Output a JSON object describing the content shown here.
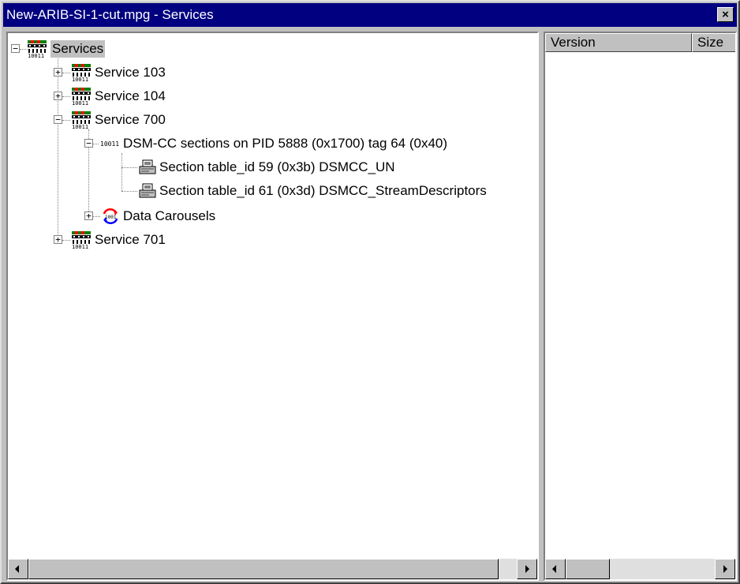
{
  "window": {
    "title": "New-ARIB-SI-1-cut.mpg - Services",
    "close_glyph": "×"
  },
  "tree": {
    "root": {
      "label": "Services",
      "expander": "−",
      "icon": "service-stream-icon"
    },
    "service_103": {
      "label": "Service 103",
      "expander": "+",
      "icon": "service-stream-icon"
    },
    "service_104": {
      "label": "Service 104",
      "expander": "+",
      "icon": "service-stream-icon"
    },
    "service_700": {
      "label": "Service 700",
      "expander": "−",
      "icon": "service-stream-icon"
    },
    "dsmcc": {
      "label": "DSM-CC sections on PID 5888 (0x1700) tag 64 (0x40)",
      "expander": "−",
      "icon": "pid-bits-icon"
    },
    "section_59": {
      "label": "Section table_id 59 (0x3b) DSMCC_UN",
      "icon": "section-table-icon"
    },
    "section_61": {
      "label": "Section table_id 61 (0x3d) DSMCC_StreamDescriptors",
      "icon": "section-table-icon"
    },
    "carousels": {
      "label": "Data Carousels",
      "expander": "+",
      "icon": "carousel-icon"
    },
    "service_701": {
      "label": "Service 701",
      "expander": "+",
      "icon": "service-stream-icon"
    }
  },
  "details": {
    "columns": [
      "Version",
      "Size"
    ]
  },
  "colors": {
    "titlebar": "#000080",
    "face": "#c0c0c0",
    "selection": "#c0c0c0"
  }
}
